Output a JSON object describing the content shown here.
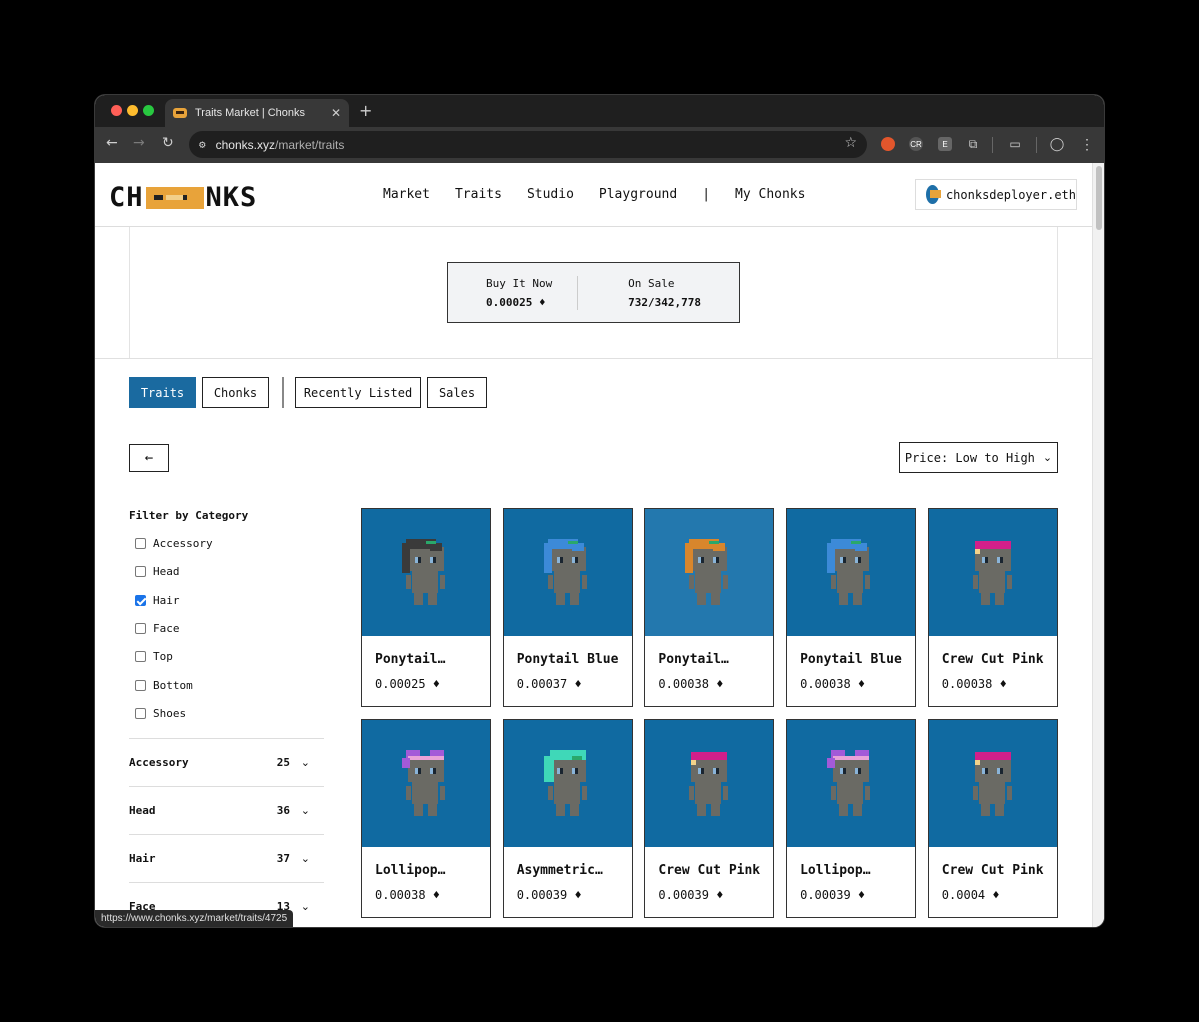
{
  "browser": {
    "tab_title": "Traits Market | Chonks",
    "tab_close": "✕",
    "new_tab": "+",
    "url_host": "chonks.xyz",
    "url_path": "/market/traits",
    "status_url": "https://www.chonks.xyz/market/traits/4725"
  },
  "header": {
    "logo_left": "CH",
    "logo_right": "NKS",
    "nav": [
      "Market",
      "Traits",
      "Studio",
      "Playground",
      "|",
      "My Chonks"
    ],
    "wallet": "chonksdeployer.eth"
  },
  "stats": {
    "buy_label": "Buy It Now",
    "buy_value": "0.00025 ♦",
    "sale_label": "On Sale",
    "sale_value": "732/342,778"
  },
  "tabs": {
    "traits": "Traits",
    "chonks": "Chonks",
    "recently_listed": "Recently Listed",
    "sales": "Sales"
  },
  "controls": {
    "back": "←",
    "sort": "Price: Low to High",
    "sort_chevron": "⌄"
  },
  "filters": {
    "title": "Filter by Category",
    "items": [
      {
        "label": "Accessory",
        "checked": false
      },
      {
        "label": "Head",
        "checked": false
      },
      {
        "label": "Hair",
        "checked": true
      },
      {
        "label": "Face",
        "checked": false
      },
      {
        "label": "Top",
        "checked": false
      },
      {
        "label": "Bottom",
        "checked": false
      },
      {
        "label": "Shoes",
        "checked": false
      }
    ]
  },
  "accordion": [
    {
      "label": "Accessory",
      "count": "25"
    },
    {
      "label": "Head",
      "count": "36"
    },
    {
      "label": "Hair",
      "count": "37"
    },
    {
      "label": "Face",
      "count": "13"
    }
  ],
  "cards": [
    {
      "name": "Ponytail…",
      "price": "0.00025 ♦",
      "hair": "ponytail-black"
    },
    {
      "name": "Ponytail Blue",
      "price": "0.00037 ♦",
      "hair": "ponytail-blue"
    },
    {
      "name": "Ponytail…",
      "price": "0.00038 ♦",
      "hair": "ponytail-orange"
    },
    {
      "name": "Ponytail Blue",
      "price": "0.00038 ♦",
      "hair": "ponytail-blue"
    },
    {
      "name": "Crew Cut Pink",
      "price": "0.00038 ♦",
      "hair": "crewcut-pink"
    },
    {
      "name": "Lollipop…",
      "price": "0.00038 ♦",
      "hair": "lollipop"
    },
    {
      "name": "Asymmetric…",
      "price": "0.00039 ♦",
      "hair": "asymmetric-teal"
    },
    {
      "name": "Crew Cut Pink",
      "price": "0.00039 ♦",
      "hair": "crewcut-pink"
    },
    {
      "name": "Lollipop…",
      "price": "0.00039 ♦",
      "hair": "lollipop"
    },
    {
      "name": "Crew Cut Pink",
      "price": "0.0004 ♦",
      "hair": "crewcut-pink"
    }
  ],
  "colors": {
    "accent": "#1a6aa0",
    "card_bg": "#106aa1",
    "card_bg_hover": "#2378ae",
    "chonk_skin": "#6a6a64",
    "hair_black": "#3a3a3a",
    "hair_blue": "#3c8ad8",
    "hair_orange": "#d8862c",
    "hair_pink": "#d21f8a",
    "hair_lollipop": "#a35ad8",
    "hair_teal": "#3fd8b8"
  }
}
